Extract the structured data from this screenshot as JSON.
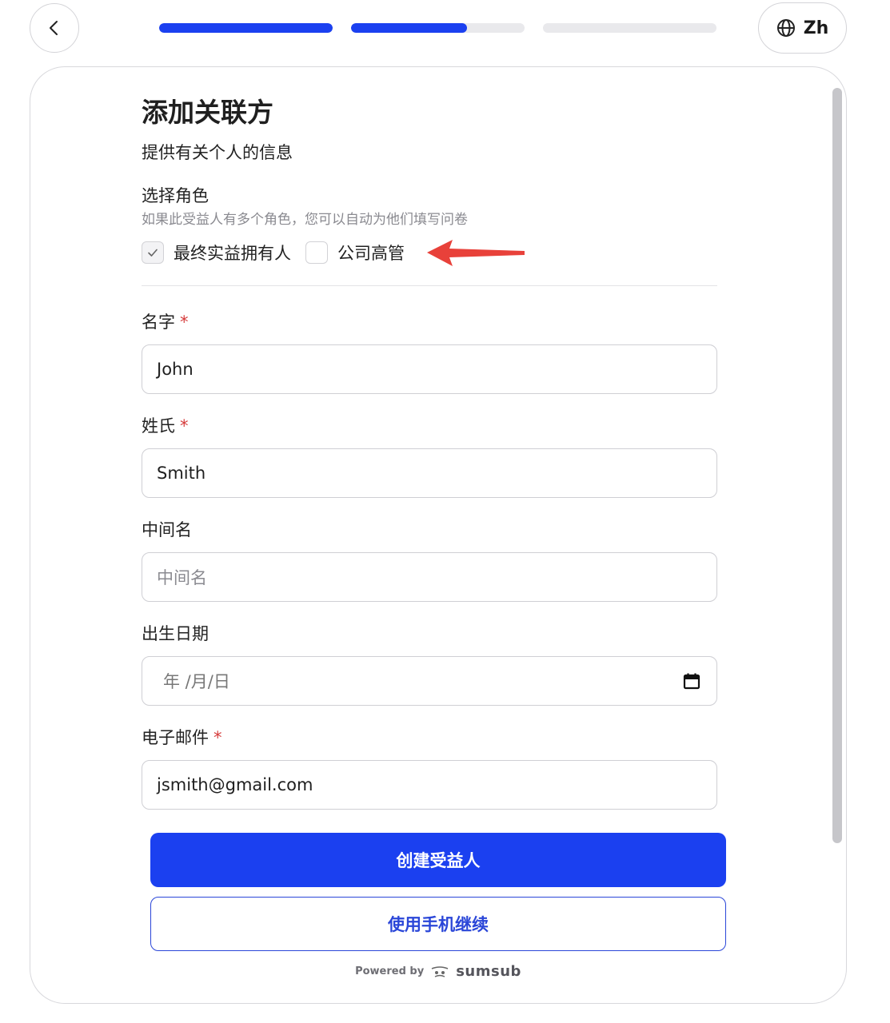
{
  "header": {
    "back_icon": "chevron-left-icon",
    "progress": [
      1.0,
      0.67,
      0.0
    ],
    "language": {
      "icon": "globe-icon",
      "label": "Zh"
    }
  },
  "form": {
    "title": "添加关联方",
    "subtitle": "提供有关个人的信息",
    "role_section": {
      "label": "选择角色",
      "hint": "如果此受益人有多个角色，您可以自动为他们填写问卷",
      "options": [
        {
          "label": "最终实益拥有人",
          "checked": true
        },
        {
          "label": "公司高管",
          "checked": false
        }
      ]
    },
    "fields": {
      "first_name": {
        "label": "名字",
        "required_mark": "*",
        "value": "John"
      },
      "last_name": {
        "label": "姓氏",
        "required_mark": "*",
        "value": "Smith"
      },
      "middle_name": {
        "label": "中间名",
        "placeholder": "中间名"
      },
      "dob": {
        "label": "出生日期",
        "placeholder": "年 /月/日",
        "icon": "calendar-icon"
      },
      "email": {
        "label": "电子邮件",
        "required_mark": "*",
        "value": "jsmith@gmail.com"
      }
    }
  },
  "actions": {
    "primary_label": "创建受益人",
    "secondary_label": "使用手机继续"
  },
  "footer": {
    "powered_by": "Powered by",
    "brand": "sumsub"
  },
  "colors": {
    "accent": "#1b40f0",
    "required": "#d63b3b",
    "annotation_arrow": "#e8413a"
  }
}
